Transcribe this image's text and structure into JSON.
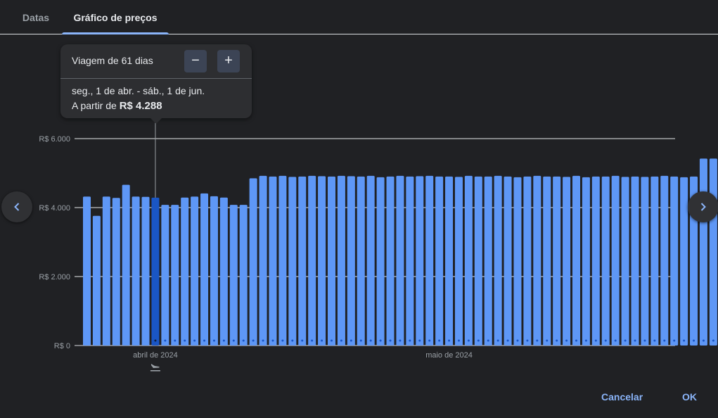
{
  "tabs": [
    {
      "label": "Datas",
      "active": false
    },
    {
      "label": "Gráfico de preços",
      "active": true
    }
  ],
  "tooltip": {
    "title": "Viagem de 61 dias",
    "minus_label": "−",
    "plus_label": "+",
    "dates": "seg., 1 de abr. - sáb., 1 de jun.",
    "price_prefix": "A partir de ",
    "price_value": "R$ 4.288"
  },
  "footer": {
    "cancel_label": "Cancelar",
    "ok_label": "OK"
  },
  "icons": {
    "left_nav": "chevron-left-icon",
    "right_nav": "chevron-right-icon",
    "departure": "flight-departure-icon"
  },
  "colors": {
    "bar": "#5e97f6",
    "bar_selected": "#1a56c5",
    "background": "#202124",
    "accent": "#8ab4f8"
  },
  "chart_data": {
    "type": "bar",
    "ytick_labels": [
      "R$ 0",
      "R$ 2.000",
      "R$ 4.000",
      "R$ 6.000"
    ],
    "yticks": [
      0,
      2000,
      4000,
      6000
    ],
    "ylim": [
      0,
      6000
    ],
    "month_labels": [
      {
        "label": "abril de 2024",
        "index": 7
      },
      {
        "label": "maio de 2024",
        "index": 37
      }
    ],
    "selected_index": 7,
    "values": [
      4320,
      3760,
      4320,
      4280,
      4660,
      4320,
      4310,
      4288,
      4080,
      4080,
      4290,
      4320,
      4410,
      4330,
      4290,
      4080,
      4080,
      4850,
      4920,
      4900,
      4920,
      4890,
      4900,
      4920,
      4910,
      4900,
      4920,
      4910,
      4900,
      4920,
      4880,
      4900,
      4920,
      4900,
      4910,
      4920,
      4900,
      4900,
      4890,
      4920,
      4900,
      4900,
      4920,
      4900,
      4880,
      4900,
      4920,
      4900,
      4900,
      4890,
      4920,
      4880,
      4900,
      4900,
      4920,
      4890,
      4900,
      4890,
      4900,
      4920,
      4900,
      4880,
      4900,
      5420,
      5420
    ],
    "grid": true
  }
}
